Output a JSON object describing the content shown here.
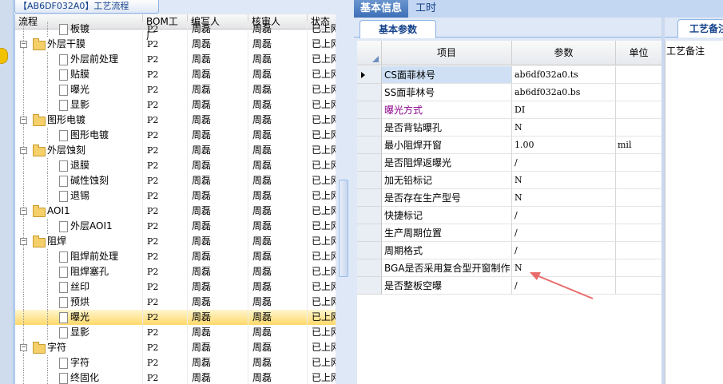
{
  "left_panel": {
    "tab_title": "【AB6DF032A0】工艺流程",
    "columns": [
      "流程",
      "BOM工厂",
      "编写人",
      "核审人",
      "状态"
    ],
    "rows": [
      {
        "name": "板镀",
        "level": 2,
        "type": "doc",
        "bom": "P2",
        "author": "周磊",
        "reviewer": "周磊",
        "status": "已上网"
      },
      {
        "name": "外层干膜",
        "level": 1,
        "type": "folder",
        "bom": "P2",
        "author": "周磊",
        "reviewer": "周磊",
        "status": "已上网"
      },
      {
        "name": "外层前处理",
        "level": 2,
        "type": "doc",
        "bom": "P2",
        "author": "周磊",
        "reviewer": "周磊",
        "status": "已上网"
      },
      {
        "name": "贴膜",
        "level": 2,
        "type": "doc",
        "bom": "P2",
        "author": "周磊",
        "reviewer": "周磊",
        "status": "已上网"
      },
      {
        "name": "曝光",
        "level": 2,
        "type": "doc",
        "bom": "P2",
        "author": "周磊",
        "reviewer": "周磊",
        "status": "已上网"
      },
      {
        "name": "显影",
        "level": 2,
        "type": "doc",
        "bom": "P2",
        "author": "周磊",
        "reviewer": "周磊",
        "status": "已上网"
      },
      {
        "name": "图形电镀",
        "level": 1,
        "type": "folder",
        "bom": "P2",
        "author": "周磊",
        "reviewer": "周磊",
        "status": "已上网"
      },
      {
        "name": "图形电镀",
        "level": 2,
        "type": "doc",
        "bom": "P2",
        "author": "周磊",
        "reviewer": "周磊",
        "status": "已上网"
      },
      {
        "name": "外层蚀刻",
        "level": 1,
        "type": "folder",
        "bom": "P2",
        "author": "周磊",
        "reviewer": "周磊",
        "status": "已上网"
      },
      {
        "name": "退膜",
        "level": 2,
        "type": "doc",
        "bom": "P2",
        "author": "周磊",
        "reviewer": "周磊",
        "status": "已上网"
      },
      {
        "name": "碱性蚀刻",
        "level": 2,
        "type": "doc",
        "bom": "P2",
        "author": "周磊",
        "reviewer": "周磊",
        "status": "已上网"
      },
      {
        "name": "退锡",
        "level": 2,
        "type": "doc",
        "bom": "P2",
        "author": "周磊",
        "reviewer": "周磊",
        "status": "已上网"
      },
      {
        "name": "AOI1",
        "level": 1,
        "type": "folder",
        "bom": "P2",
        "author": "周磊",
        "reviewer": "周磊",
        "status": "已上网"
      },
      {
        "name": "外层AOI1",
        "level": 2,
        "type": "doc",
        "bom": "P2",
        "author": "周磊",
        "reviewer": "周磊",
        "status": "已上网"
      },
      {
        "name": "阻焊",
        "level": 1,
        "type": "folder",
        "bom": "P2",
        "author": "周磊",
        "reviewer": "周磊",
        "status": "已上网"
      },
      {
        "name": "阻焊前处理",
        "level": 2,
        "type": "doc",
        "bom": "P2",
        "author": "周磊",
        "reviewer": "周磊",
        "status": "已上网"
      },
      {
        "name": "阻焊塞孔",
        "level": 2,
        "type": "doc",
        "bom": "P2",
        "author": "周磊",
        "reviewer": "周磊",
        "status": "已上网"
      },
      {
        "name": "丝印",
        "level": 2,
        "type": "doc",
        "bom": "P2",
        "author": "周磊",
        "reviewer": "周磊",
        "status": "已上网"
      },
      {
        "name": "预烘",
        "level": 2,
        "type": "doc",
        "bom": "P2",
        "author": "周磊",
        "reviewer": "周磊",
        "status": "已上网"
      },
      {
        "name": "曝光",
        "level": 2,
        "type": "doc",
        "bom": "P2",
        "author": "周磊",
        "reviewer": "周磊",
        "status": "已上网",
        "selected": true
      },
      {
        "name": "显影",
        "level": 2,
        "type": "doc",
        "bom": "P2",
        "author": "周磊",
        "reviewer": "周磊",
        "status": "已上网"
      },
      {
        "name": "字符",
        "level": 1,
        "type": "folder",
        "bom": "P2",
        "author": "周磊",
        "reviewer": "周磊",
        "status": "已上网"
      },
      {
        "name": "字符",
        "level": 2,
        "type": "doc",
        "bom": "P2",
        "author": "周磊",
        "reviewer": "周磊",
        "status": "已上网"
      },
      {
        "name": "终固化",
        "level": 2,
        "type": "doc",
        "bom": "P2",
        "author": "周磊",
        "reviewer": "周磊",
        "status": "已上网"
      }
    ]
  },
  "top_tabs": {
    "basic_info": "基本信息",
    "work_time": "工时"
  },
  "sub_tab": "基本参数",
  "param_grid": {
    "columns": {
      "item": "项目",
      "param": "参数",
      "unit": "单位"
    },
    "rows": [
      {
        "item": "CS面菲林号",
        "param": "ab6df032a0.ts",
        "unit": "",
        "current": true
      },
      {
        "item": "SS面菲林号",
        "param": "ab6df032a0.bs",
        "unit": ""
      },
      {
        "item": "曝光方式",
        "param": "DI",
        "unit": "",
        "highlight": true
      },
      {
        "item": "是否背钻曝孔",
        "param": "N",
        "unit": ""
      },
      {
        "item": "最小阻焊开窗",
        "param": "1.00",
        "unit": "mil"
      },
      {
        "item": "是否阻焊返曝光",
        "param": "/",
        "unit": ""
      },
      {
        "item": "加无铅标记",
        "param": "N",
        "unit": ""
      },
      {
        "item": "是否存在生产型号",
        "param": "N",
        "unit": ""
      },
      {
        "item": "快捷标记",
        "param": "/",
        "unit": ""
      },
      {
        "item": "生产周期位置",
        "param": "/",
        "unit": ""
      },
      {
        "item": "周期格式",
        "param": "/",
        "unit": ""
      },
      {
        "item": "BGA是否采用复合型开窗制作",
        "param": "N",
        "unit": ""
      },
      {
        "item": "是否整板空曝",
        "param": "/",
        "unit": ""
      }
    ]
  },
  "remark_panel": {
    "tab": "工艺备注",
    "field_label": "工艺备注"
  },
  "colors": {
    "accent": "#3d6fb7",
    "highlight_text": "#8b008b",
    "selection": "#ffd96a",
    "annotation_arrow": "#e86b6b"
  }
}
